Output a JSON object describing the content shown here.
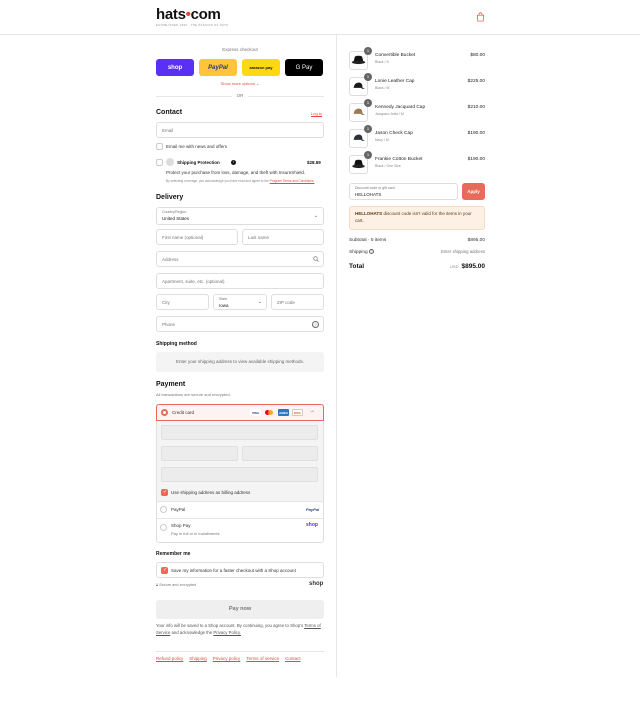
{
  "header": {
    "logo_main": "hats",
    "logo_dot": "•",
    "logo_tld": "com",
    "tagline": "ESTABLISHED 1995 · THE PASSION OF HATS",
    "cart_icon": "shopping-bag-icon"
  },
  "express": {
    "title": "Express checkout",
    "buttons": [
      {
        "label": "shop",
        "bg": "#5a31f4",
        "fg": "#ffffff"
      },
      {
        "label": "PayPal",
        "bg": "#ffc439",
        "fg": "#253b80"
      },
      {
        "label": "amazon pay",
        "bg": "#ffd814",
        "fg": "#111111"
      },
      {
        "label": "G Pay",
        "bg": "#000000",
        "fg": "#ffffff"
      }
    ],
    "show_more": "Show more options ⌄",
    "or": "OR"
  },
  "contact": {
    "heading": "Contact",
    "login": "Log in",
    "email_placeholder": "Email",
    "news_label": "Email me with news and offers",
    "protection_title": "Shipping Protection",
    "protection_price": "$28.59",
    "protection_desc": "Protect your purchase from loss, damage, and theft with InsureShield.",
    "protection_fine": "By selecting coverage, you acknowledge you have read and agree to the",
    "protection_link": "Program Terms and Conditions."
  },
  "delivery": {
    "heading": "Delivery",
    "country_label": "Country/Region",
    "country_value": "United States",
    "first_name": "First name (optional)",
    "last_name": "Last name",
    "address": "Address",
    "apartment": "Apartment, suite, etc. (optional)",
    "city": "City",
    "state_label": "State",
    "state_value": "Iowa",
    "zip": "ZIP code",
    "phone": "Phone"
  },
  "shipping_method": {
    "heading": "Shipping method",
    "message": "Enter your shipping address to view available shipping methods."
  },
  "payment": {
    "heading": "Payment",
    "subtitle": "All transactions are secure and encrypted.",
    "credit_card": "Credit card",
    "card_logos": [
      "VISA",
      "MC",
      "AMEX",
      "DISC"
    ],
    "billing_same": "Use shipping address as billing address",
    "paypal": "PayPal",
    "paypal_logo": "PayPal",
    "shoppay": "Shop Pay",
    "shoppay_desc": "Pay in full or in installments",
    "shoppay_logo": "shop"
  },
  "remember": {
    "heading": "Remember me",
    "save_label": "Save my information for a faster checkout with a Shop account",
    "secure": "Secure and encrypted",
    "shop_logo": "shop"
  },
  "pay_now": "Pay now",
  "legal": {
    "text1": "Your info will be saved to a Shop account. By continuing, you agree to Shop's",
    "tos": "Terms of Service",
    "text2": "and acknowledge the",
    "privacy": "Privacy Policy."
  },
  "footer_links": [
    "Refund policy",
    "Shipping",
    "Privacy policy",
    "Terms of service",
    "Contact"
  ],
  "cart": {
    "items": [
      {
        "qty": "1",
        "name": "Convertible Bucket",
        "variant": "Black / S",
        "price": "$80.00"
      },
      {
        "qty": "1",
        "name": "Lonie Leather Cap",
        "variant": "Black / M",
        "price": "$225.00"
      },
      {
        "qty": "1",
        "name": "Kennedy Jacquard Cap",
        "variant": "Jacquard Jetta / M",
        "price": "$210.00"
      },
      {
        "qty": "1",
        "name": "Jason Check Cap",
        "variant": "Navy / M",
        "price": "$190.00"
      },
      {
        "qty": "1",
        "name": "Frankie Cotton Bucket",
        "variant": "Black / One Size",
        "price": "$190.00"
      }
    ],
    "discount_label": "Discount code or gift card",
    "discount_value": "HELLOHATS",
    "apply": "Apply",
    "warning_code": "HELLOHATS",
    "warning_text": "discount code isn't valid for the items in your cart.",
    "subtotal_label": "Subtotal · 5 items",
    "subtotal_value": "$895.00",
    "shipping_label": "Shipping",
    "shipping_value": "Enter shipping address",
    "total_label": "Total",
    "currency": "USD",
    "total_value": "$895.00"
  }
}
